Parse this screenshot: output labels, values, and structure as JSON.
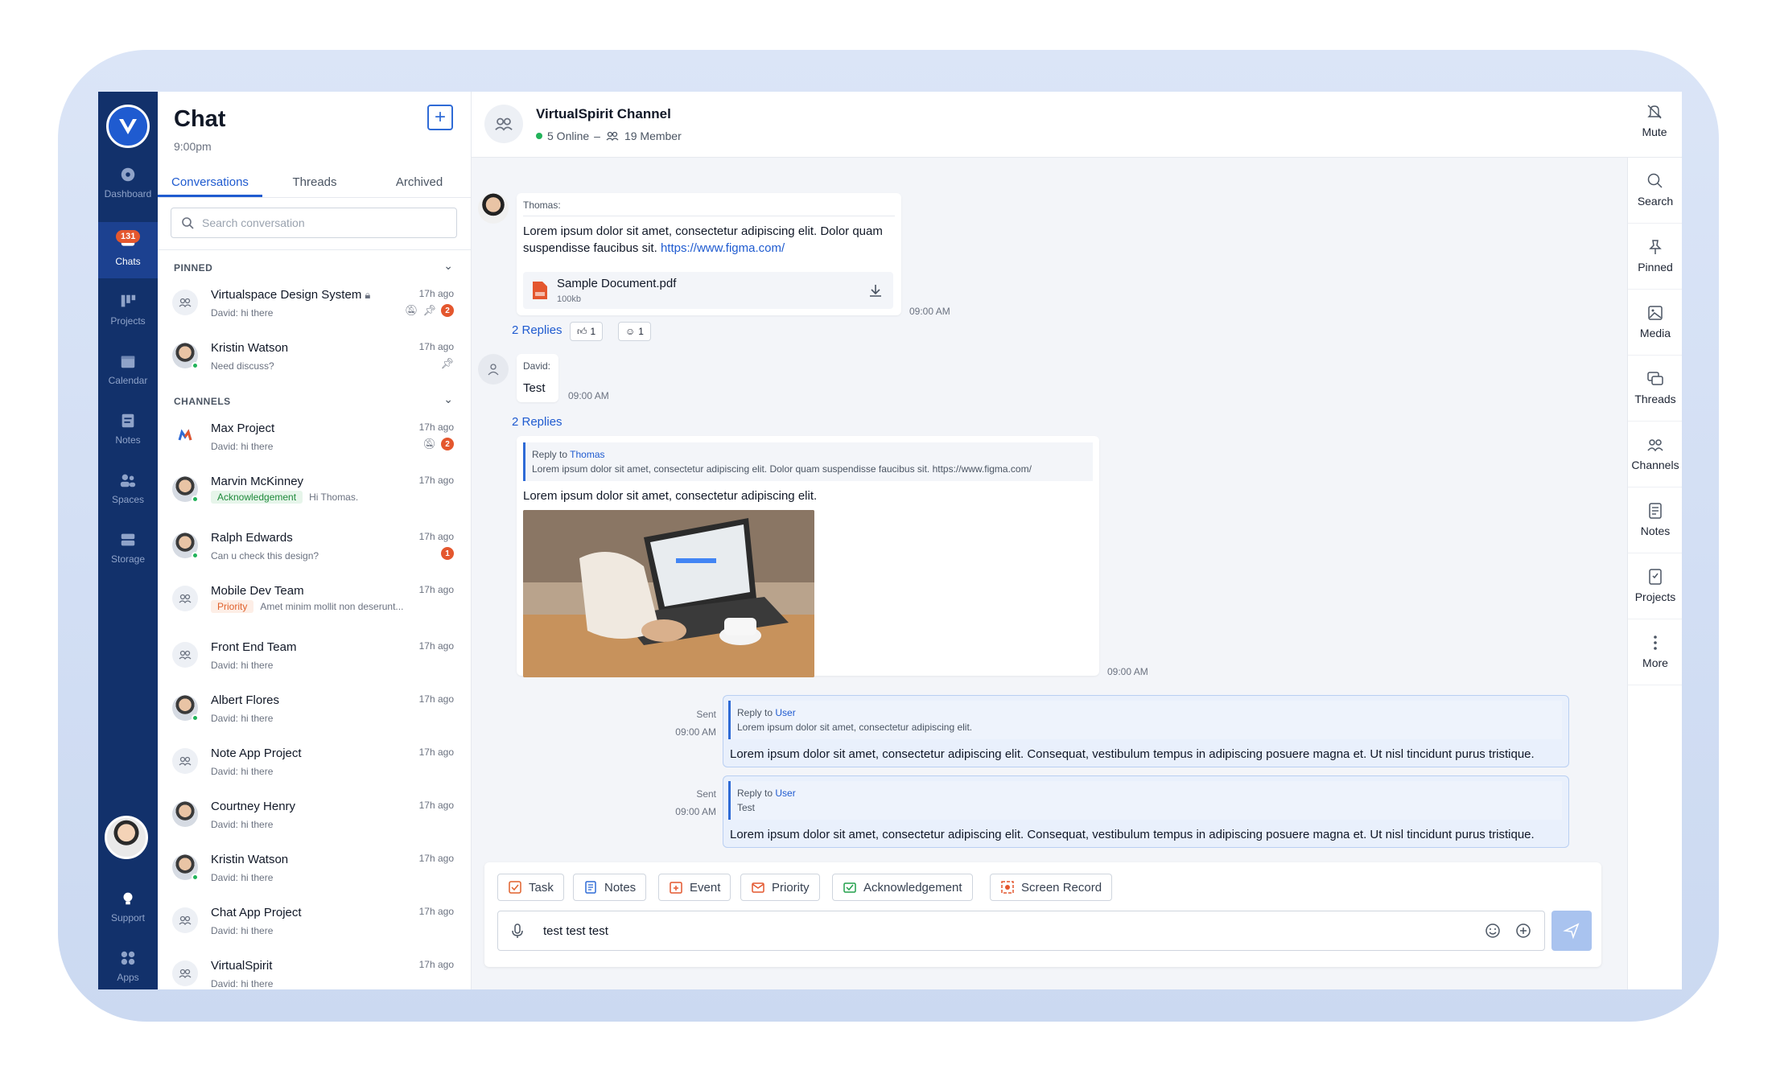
{
  "nav": {
    "items": [
      {
        "label": "Dashboard",
        "icon": "dashboard-icon"
      },
      {
        "label": "Chats",
        "icon": "chat-icon",
        "badge": "131"
      },
      {
        "label": "Projects",
        "icon": "projects-icon"
      },
      {
        "label": "Calendar",
        "icon": "calendar-icon"
      },
      {
        "label": "Notes",
        "icon": "notes-icon"
      },
      {
        "label": "Spaces",
        "icon": "spaces-icon"
      },
      {
        "label": "Storage",
        "icon": "storage-icon"
      }
    ],
    "bottom": [
      {
        "label": "Support",
        "icon": "bulb-icon"
      },
      {
        "label": "Apps",
        "icon": "apps-icon"
      }
    ]
  },
  "list": {
    "title": "Chat",
    "time": "9:00pm",
    "tabs": [
      "Conversations",
      "Threads",
      "Archived"
    ],
    "search_placeholder": "Search conversation",
    "pinned_label": "PINNED",
    "channels_label": "CHANNELS",
    "pinned": [
      {
        "name": "Virtualspace Design System",
        "sub": "David: hi there",
        "time": "17h ago",
        "badge": "2"
      },
      {
        "name": "Kristin Watson",
        "sub": "Need discuss?",
        "time": "17h ago"
      }
    ],
    "channels": [
      {
        "name": "Max Project",
        "sub": "David: hi there",
        "time": "17h ago",
        "badge": "2"
      },
      {
        "name": "Marvin McKinney",
        "tag": "Acknowledgement",
        "sub": "Hi Thomas.",
        "time": "17h ago"
      },
      {
        "name": "Ralph Edwards",
        "sub": "Can u check this design?",
        "time": "17h ago",
        "badge": "1"
      },
      {
        "name": "Mobile Dev Team",
        "tag": "Priority",
        "sub": "Amet minim mollit non deserunt...",
        "time": "17h ago"
      },
      {
        "name": "Front End Team",
        "sub": "David: hi there",
        "time": "17h ago"
      },
      {
        "name": "Albert Flores",
        "sub": "David: hi there",
        "time": "17h ago"
      },
      {
        "name": "Note App Project",
        "sub": "David: hi there",
        "time": "17h ago"
      },
      {
        "name": "Courtney Henry",
        "sub": "David: hi there",
        "time": "17h ago"
      },
      {
        "name": "Kristin Watson",
        "sub": "David: hi there",
        "time": "17h ago"
      },
      {
        "name": "Chat App Project",
        "sub": "David: hi there",
        "time": "17h ago"
      },
      {
        "name": "VirtualSpirit",
        "sub": "David: hi there",
        "time": "17h ago"
      }
    ]
  },
  "header": {
    "title": "VirtualSpirit Channel",
    "online": "5 Online",
    "separator": "–",
    "members": "19 Member",
    "mute": "Mute"
  },
  "rail": [
    "Search",
    "Pinned",
    "Media",
    "Threads",
    "Channels",
    "Notes",
    "Projects",
    "More"
  ],
  "messages": {
    "m1": {
      "sender": "Thomas:",
      "text": "Lorem ipsum dolor sit amet, consectetur adipiscing elit. Dolor quam suspendisse faucibus sit.",
      "link": "https://www.figma.com/",
      "file_name": "Sample Document.pdf",
      "file_size": "100kb",
      "time": "09:00 AM",
      "replies": "2 Replies",
      "reaction1": "1",
      "reaction2": "1"
    },
    "m2": {
      "sender": "David:",
      "text": "Test",
      "time": "09:00 AM",
      "replies": "2 Replies"
    },
    "m3": {
      "reply_prefix": "Reply to",
      "reply_to": "Thomas",
      "quote": "Lorem ipsum dolor sit amet, consectetur adipiscing elit. Dolor quam suspendisse faucibus sit. https://www.figma.com/",
      "text": "Lorem ipsum dolor sit amet, consectetur adipiscing elit.",
      "time": "09:00 AM"
    },
    "s1": {
      "status": "Sent",
      "time": "09:00 AM",
      "reply_prefix": "Reply to",
      "reply_to": "User",
      "quote": "Lorem ipsum dolor sit amet, consectetur adipiscing elit.",
      "text": "Lorem ipsum dolor sit amet, consectetur adipiscing elit. Consequat, vestibulum tempus in adipiscing posuere magna et. Ut nisl tincidunt purus tristique."
    },
    "s2": {
      "status": "Sent",
      "time": "09:00 AM",
      "reply_prefix": "Reply to",
      "reply_to": "User",
      "quote": "Test",
      "text": "Lorem ipsum dolor sit amet, consectetur adipiscing elit. Consequat, vestibulum tempus in adipiscing posuere magna et. Ut nisl tincidunt purus tristique."
    }
  },
  "composer": {
    "tools": [
      "Task",
      "Notes",
      "Event",
      "Priority",
      "Acknowledgement",
      "Screen Record"
    ],
    "value": "test test test"
  },
  "colors": {
    "nav_bg": "#12316b",
    "accent": "#1f5bd0",
    "badge": "#e4572e",
    "online": "#22b35a"
  }
}
